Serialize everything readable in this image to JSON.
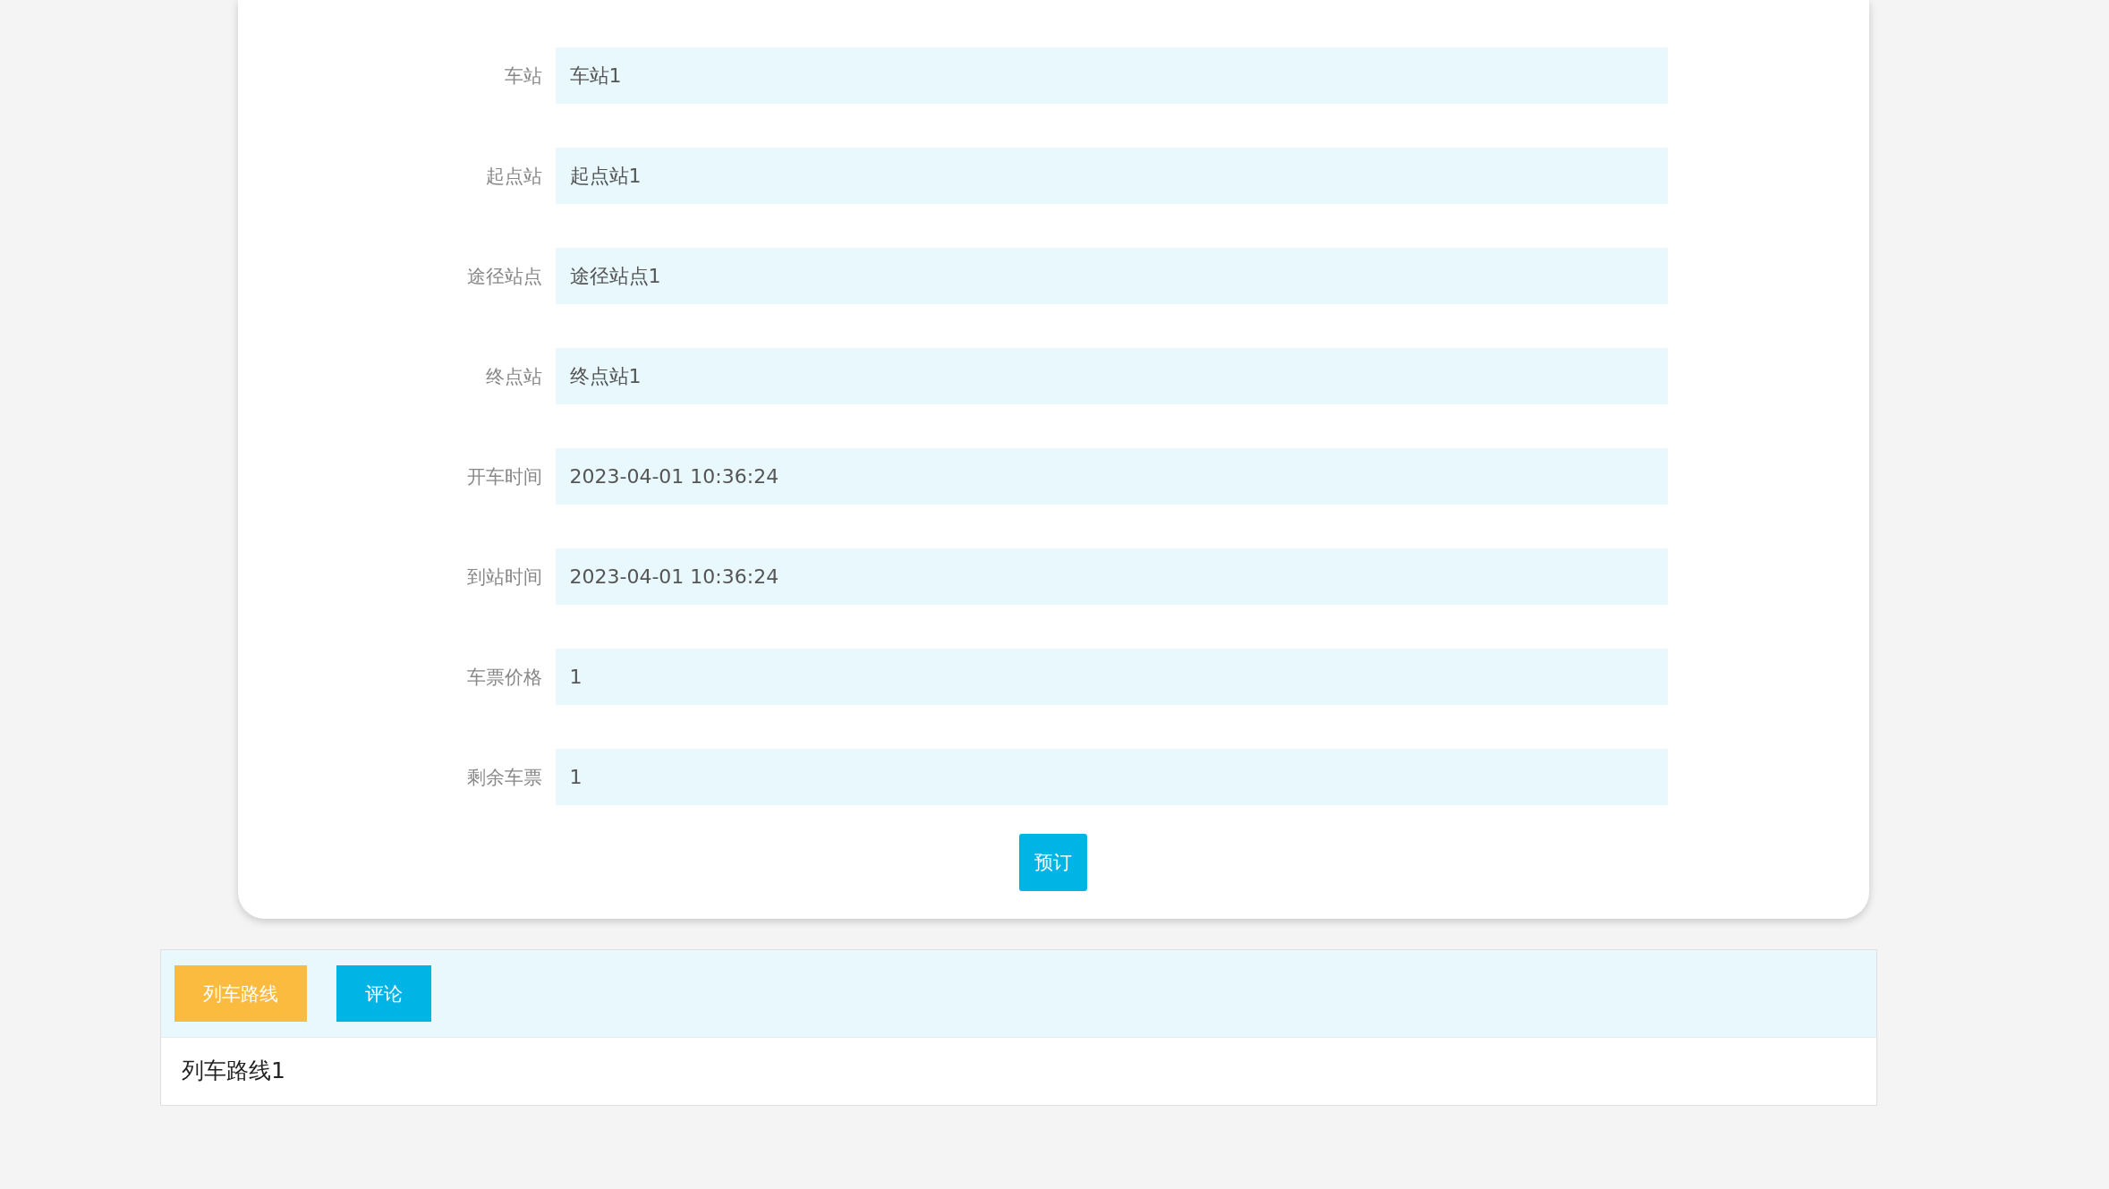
{
  "form": {
    "fields": [
      {
        "label": "车站",
        "value": "车站1"
      },
      {
        "label": "起点站",
        "value": "起点站1"
      },
      {
        "label": "途径站点",
        "value": "途径站点1"
      },
      {
        "label": "终点站",
        "value": "终点站1"
      },
      {
        "label": "开车时间",
        "value": "2023-04-01 10:36:24"
      },
      {
        "label": "到站时间",
        "value": "2023-04-01 10:36:24"
      },
      {
        "label": "车票价格",
        "value": "1"
      },
      {
        "label": "剩余车票",
        "value": "1"
      }
    ],
    "submit": "预订"
  },
  "tabs": [
    {
      "label": "列车路线",
      "selected": true
    },
    {
      "label": "评论",
      "selected": false
    }
  ],
  "tab_content": "列车路线1"
}
